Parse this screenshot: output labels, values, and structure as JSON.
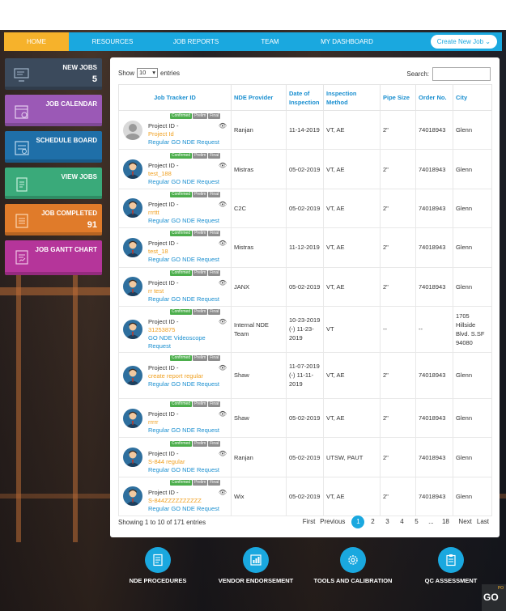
{
  "nav": {
    "items": [
      "HOME",
      "RESOURCES",
      "JOB REPORTS",
      "TEAM",
      "MY DASHBOARD"
    ],
    "create_button": "Create New Job",
    "accent": "#1aa8df",
    "active_color": "#f6b22b"
  },
  "sidebar": {
    "tiles": [
      {
        "label": "NEW JOBS",
        "count": "5",
        "color": "#3b4a5c",
        "icon": "monitor-icon"
      },
      {
        "label": "JOB CALENDAR",
        "count": "",
        "color": "#9b59b6",
        "icon": "calendar-icon"
      },
      {
        "label": "SCHEDULE BOARD",
        "count": "",
        "color": "#1f6fa8",
        "icon": "board-icon"
      },
      {
        "label": "VIEW JOBS",
        "count": "",
        "color": "#3aaa7a",
        "icon": "document-icon"
      },
      {
        "label": "JOB COMPLETED",
        "count": "91",
        "color": "#e07b2a",
        "icon": "checklist-icon"
      },
      {
        "label": "JOB GANTT CHART",
        "count": "",
        "color": "#b5359a",
        "icon": "chart-icon"
      }
    ]
  },
  "table_controls": {
    "show_label": "Show",
    "entries_value": "10",
    "entries_label": "entries",
    "search_label": "Search:"
  },
  "columns": [
    "Job Tracker ID",
    "NDE Provider",
    "Date of Inspection",
    "Inspection Method",
    "Pipe Size",
    "Order No.",
    "City"
  ],
  "badges": {
    "confirmed": "Confirmed",
    "prelim": "Prelim",
    "final": "Final"
  },
  "rows": [
    {
      "pid": "Project ID -",
      "name": "Project Id",
      "request": "Regular GO NDE Request",
      "provider": "Ranjan",
      "date": "11-14-2019",
      "method": "VT, AE",
      "pipe": "2\"",
      "order": "74018943",
      "city": "Glenn",
      "avatar": "default"
    },
    {
      "pid": "Project ID -",
      "name": "test_188",
      "request": "Regular GO NDE Request",
      "provider": "Mistras",
      "date": "05-02-2019",
      "method": "VT, AE",
      "pipe": "2\"",
      "order": "74018943",
      "city": "Glenn",
      "avatar": "person"
    },
    {
      "pid": "Project ID -",
      "name": "rrrttt",
      "request": "Regular GO NDE Request",
      "provider": "C2C",
      "date": "05-02-2019",
      "method": "VT, AE",
      "pipe": "2\"",
      "order": "74018943",
      "city": "Glenn",
      "avatar": "person"
    },
    {
      "pid": "Project ID -",
      "name": "test_18",
      "request": "Regular GO NDE Request",
      "provider": "Mistras",
      "date": "11-12-2019",
      "method": "VT, AE",
      "pipe": "2\"",
      "order": "74018943",
      "city": "Glenn",
      "avatar": "person"
    },
    {
      "pid": "Project ID -",
      "name": "rr test",
      "request": "Regular GO NDE Request",
      "provider": "JANX",
      "date": "05-02-2019",
      "method": "VT, AE",
      "pipe": "2\"",
      "order": "74018943",
      "city": "Glenn",
      "avatar": "person"
    },
    {
      "pid": "Project ID -",
      "name": "31253875",
      "request": "GO NDE Videoscope Request",
      "provider": "Internal NDE Team",
      "date": "10-23-2019 (-) 11-23-2019",
      "method": "VT",
      "pipe": "--",
      "order": "--",
      "city": "1705 Hillside Blvd. S.SF 94080",
      "avatar": "person",
      "tall": true
    },
    {
      "pid": "Project ID -",
      "name": "create report regular",
      "request": "Regular GO NDE Request",
      "provider": "Shaw",
      "date": "11-07-2019 (-) 11-11-2019",
      "method": "VT, AE",
      "pipe": "2\"",
      "order": "74018943",
      "city": "Glenn",
      "avatar": "person",
      "tall": true
    },
    {
      "pid": "Project ID -",
      "name": "rrrrr",
      "request": "Regular GO NDE Request",
      "provider": "Shaw",
      "date": "05-02-2019",
      "method": "VT, AE",
      "pipe": "2\"",
      "order": "74018943",
      "city": "Glenn",
      "avatar": "person"
    },
    {
      "pid": "Project ID -",
      "name": "S-844 regular",
      "request": "Regular GO NDE Request",
      "provider": "Ranjan",
      "date": "05-02-2019",
      "method": "UTSW, PAUT",
      "pipe": "2\"",
      "order": "74018943",
      "city": "Glenn",
      "avatar": "person"
    },
    {
      "pid": "Project ID -",
      "name": "S-844ZZZZZZZZZZ",
      "request": "Regular GO NDE Request",
      "provider": "Wix",
      "date": "05-02-2019",
      "method": "VT, AE",
      "pipe": "2\"",
      "order": "74018943",
      "city": "Glenn",
      "avatar": "person"
    }
  ],
  "footer": {
    "info": "Showing 1 to 10 of 171 entries",
    "first": "First",
    "previous": "Previous",
    "pages": [
      "1",
      "2",
      "3",
      "4",
      "5",
      "...",
      "18"
    ],
    "active_page": "1",
    "next": "Next",
    "last": "Last"
  },
  "tools": [
    {
      "label": "NDE PROCEDURES",
      "icon": "document-icon"
    },
    {
      "label": "VENDOR ENDORSEMENT",
      "icon": "chart-icon"
    },
    {
      "label": "TOOLS AND CALIBRATION",
      "icon": "gear-icon"
    },
    {
      "label": "QC ASSESSMENT",
      "icon": "clipboard-icon"
    }
  ],
  "brand": {
    "small": "PO",
    "big": "GO"
  }
}
